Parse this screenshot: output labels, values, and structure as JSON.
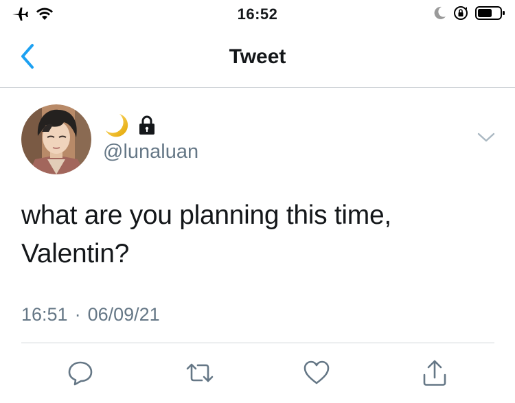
{
  "status_bar": {
    "time": "16:52",
    "left_icons": [
      "airplane-icon",
      "wifi-icon"
    ],
    "right_icons": [
      "moon-icon",
      "orientation-lock-icon",
      "battery-icon"
    ]
  },
  "nav": {
    "title": "Tweet",
    "back_icon": "chevron-left-icon",
    "accent_color": "#1da1f2"
  },
  "tweet": {
    "display_name_icons": [
      "crescent-moon-icon",
      "lock-icon"
    ],
    "handle": "@lunaluan",
    "text_lines": [
      "what are you planning this time,",
      "Valentin?"
    ],
    "time": "16:51",
    "separator": "·",
    "date": "06/09/21",
    "menu_icon": "chevron-down-icon"
  },
  "actions": [
    {
      "name": "reply",
      "icon": "comment-icon"
    },
    {
      "name": "retweet",
      "icon": "retweet-icon"
    },
    {
      "name": "like",
      "icon": "heart-icon"
    },
    {
      "name": "share",
      "icon": "share-icon"
    }
  ],
  "colors": {
    "text": "#14171a",
    "secondary": "#657786",
    "divider": "#d0d4d8",
    "accent": "#1da1f2",
    "icon_gray": "#657786"
  }
}
